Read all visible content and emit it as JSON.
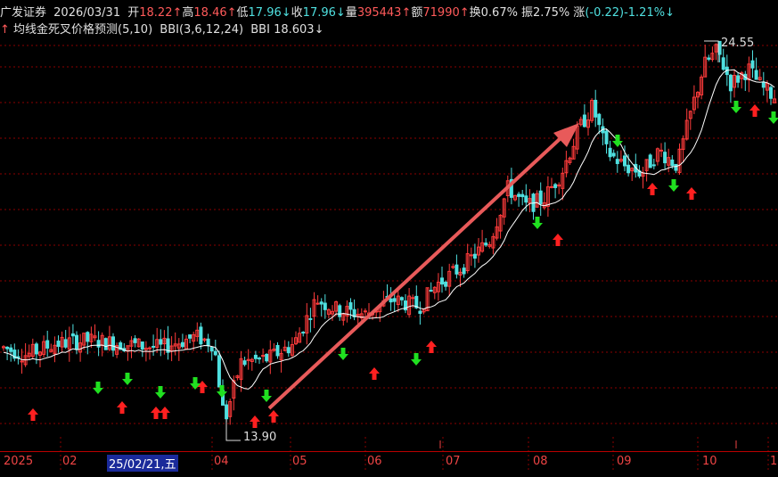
{
  "header": {
    "stock_name": "广发证券",
    "date": "2026/03/31",
    "open_label": "开",
    "open_value": "18.22",
    "open_arrow": "↑",
    "high_label": "高",
    "high_value": "18.46",
    "high_arrow": "↑",
    "low_label": "低",
    "low_value": "17.96",
    "low_arrow": "↓",
    "close_label": "收",
    "close_value": "17.96",
    "close_arrow": "↓",
    "volume_label": "量",
    "volume_value": "395443",
    "volume_arrow": "↑",
    "amount_label": "额",
    "amount_value": "71990",
    "amount_arrow": "↑",
    "turnover_label": "换",
    "turnover_value": "0.67%",
    "amplitude_label": "振",
    "amplitude_value": "2.75%",
    "change_label": "涨",
    "change_value": "(-0.22)-1.21%↓"
  },
  "indicator": {
    "arrow": "↑",
    "name": "均线金死叉价格预测(5,10)",
    "bbi_params": "BBI(3,6,12,24)",
    "bbi_label": "BBI",
    "bbi_value": "18.603",
    "bbi_arrow": "↓"
  },
  "annotations": {
    "max_label": "24.55",
    "min_label": "13.90"
  },
  "xaxis": {
    "ticks": [
      "2025",
      "02",
      "04",
      "05",
      "06",
      "07",
      "08",
      "09",
      "10",
      "1"
    ],
    "cursor_date": "25/02/21,五"
  },
  "colors": {
    "up": "#ff3b3b",
    "down": "#4fe0e0",
    "bbi": "#ffffff",
    "grid": "#8b0000",
    "trend_arrow": "#e85a5a",
    "buy_signal": "#ff2020",
    "sell_signal": "#20e020"
  },
  "chart_data": {
    "type": "candlestick",
    "price_range": [
      13.5,
      25.5
    ],
    "period_start": "2025-01",
    "period_end": "2025-11",
    "max_price": 24.55,
    "min_price": 13.9,
    "bbi_last": 18.603
  }
}
